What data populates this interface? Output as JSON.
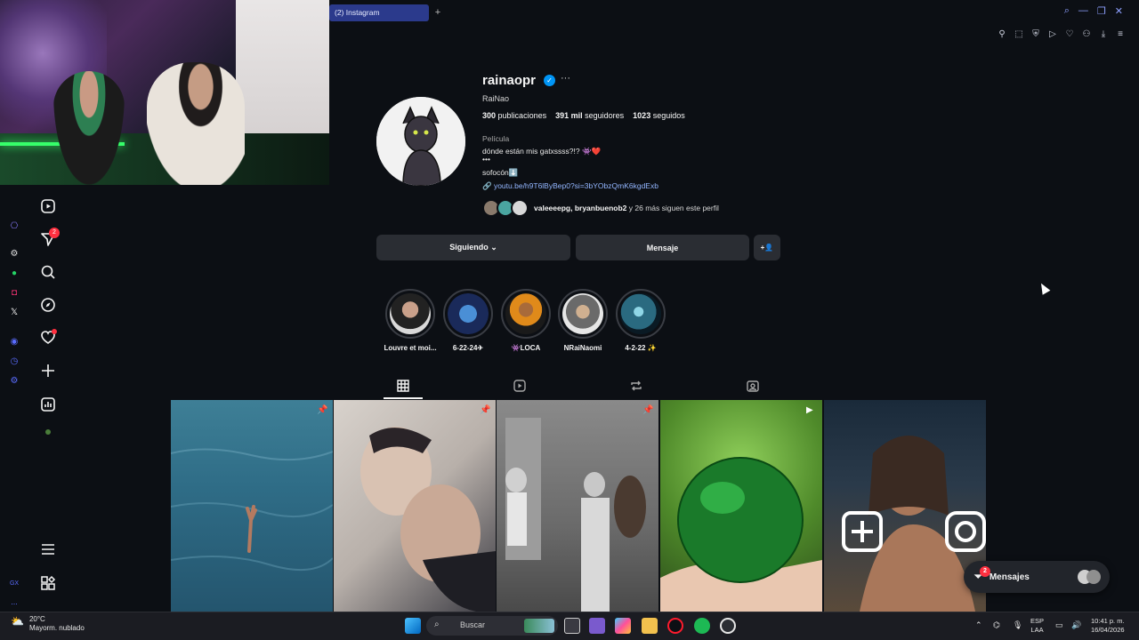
{
  "browser": {
    "tab_title": "(2) Instagram",
    "new_tab": "+",
    "window_controls": [
      "search-icon",
      "minimize-icon",
      "restore-icon",
      "close-icon"
    ],
    "toolbar_icons": [
      "bookmark-icon",
      "screenshot-icon",
      "shield-icon",
      "play-icon",
      "heart-icon",
      "account-icon",
      "download-icon",
      "menu-icon"
    ]
  },
  "left_sidebar": {
    "icons": [
      "gamepad-icon",
      "chatgpt-icon",
      "whatsapp-icon",
      "instagram-icon",
      "x-icon",
      "player-icon",
      "history-icon",
      "settings-icon"
    ],
    "bottom": [
      "GX",
      "..."
    ]
  },
  "ig_nav": {
    "items": [
      "reels-icon",
      "messages-icon",
      "search-icon",
      "explore-icon",
      "notifications-icon",
      "create-icon",
      "dashboard-icon",
      "more-icon",
      "threads-icon"
    ],
    "messages_badge": "2"
  },
  "profile": {
    "username": "rainaopr",
    "verified": "✓",
    "more": "···",
    "full_name": "RaiNao",
    "stats": [
      {
        "value": "300",
        "label": "publicaciones"
      },
      {
        "value": "391 mil",
        "label": "seguidores"
      },
      {
        "value": "1023",
        "label": "seguidos"
      }
    ],
    "category": "Película",
    "bio_line1": "dónde están mis gatxssss?!? 👾❤️",
    "bio_line2": "•••",
    "bio_line3": "sofocón⬇️",
    "link": "youtu.be/h9T6lByBep0?si=3bYObzQmK6kgdExb",
    "followed_by_names": "valeeeepg, bryanbuenob2",
    "followed_by_rest": " y 26 más siguen este perfil",
    "buttons": {
      "following": "Siguiendo ⌄",
      "message": "Mensaje",
      "add_person": "+👤"
    }
  },
  "highlights": [
    {
      "label": "Louvre et moi..."
    },
    {
      "label": "6-22-24✈"
    },
    {
      "label": "👾LOCA"
    },
    {
      "label": "NRaiNaomi"
    },
    {
      "label": "4-2-22 ✨"
    }
  ],
  "profile_tabs": [
    "grid-icon",
    "reels-icon",
    "reposts-icon",
    "tagged-icon"
  ],
  "posts": [
    {
      "desc": "hand-in-ocean",
      "badge": "pin-icon"
    },
    {
      "desc": "face-makeup-portrait",
      "badge": "pin-icon"
    },
    {
      "desc": "bw-band-studio",
      "badge": "pin-icon"
    },
    {
      "desc": "green-crystal-ball",
      "badge": "reel-icon"
    },
    {
      "desc": "woman-beach-night",
      "badge": ""
    }
  ],
  "messages_pill": {
    "label": "Mensajes",
    "badge": "2"
  },
  "taskbar": {
    "weather_temp": "20°C",
    "weather_desc": "Mayorm. nublado",
    "search_placeholder": "Buscar",
    "lang": "ESP",
    "lang2": "LAA",
    "time": "10:41 p. m.",
    "date": "16/04/2026"
  },
  "colors": {
    "background": "#0c0f14",
    "button_bg": "#2a2d33",
    "verified": "#0095f6",
    "badge": "#ff3040",
    "link": "#93b6ff",
    "tab_active": "#2b3a8c"
  }
}
